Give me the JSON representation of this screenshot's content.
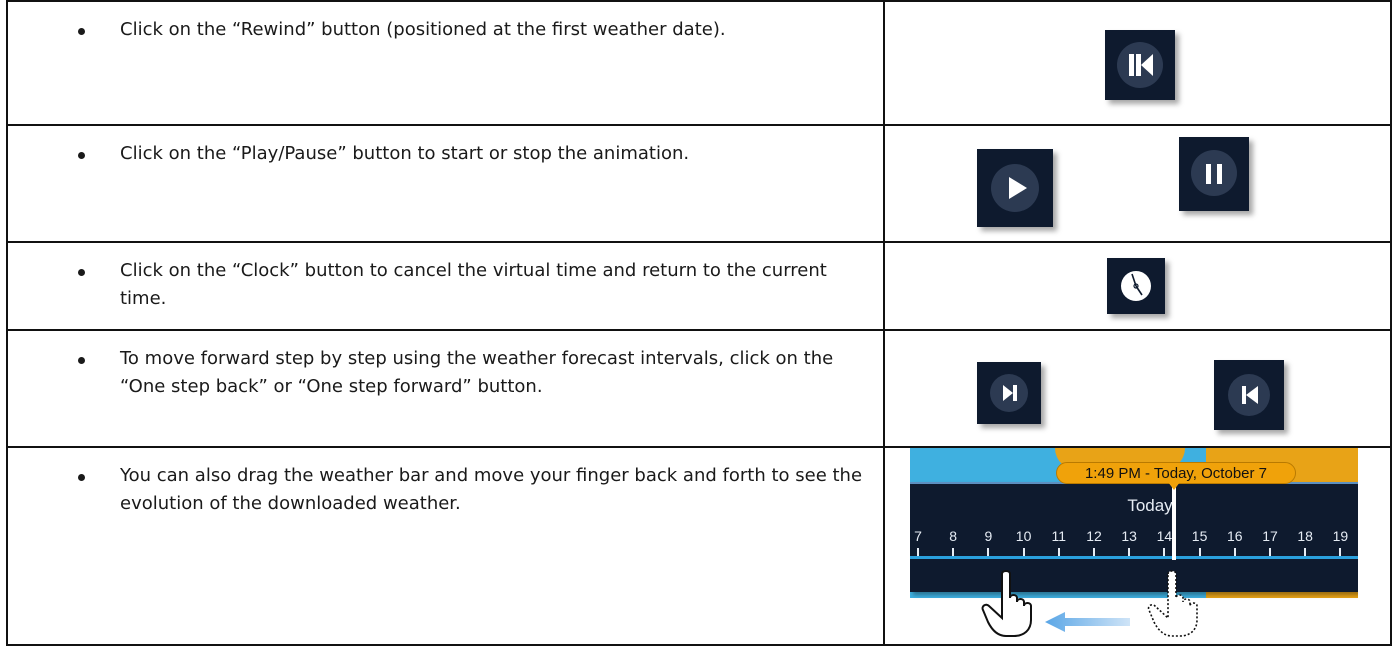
{
  "rows": [
    {
      "text": "Click on the “Rewind” button (positioned at the first weather date).",
      "icon": "rewind-icon"
    },
    {
      "text": "Click on the “Play/Pause” button to start or stop the animation.",
      "icons": [
        "play-icon",
        "pause-icon"
      ]
    },
    {
      "text": "Click on the “Clock” button to cancel the virtual time and return to the current time.",
      "icon": "clock-icon"
    },
    {
      "text": "To move forward step by step using the weather forecast intervals, click on the “One step back” or “One step forward” button.",
      "icons": [
        "step-forward-icon",
        "step-back-icon"
      ]
    },
    {
      "text": "You can also drag the weather bar and move your finger back and forth to see the evolution of the downloaded weather.",
      "icon": "weather-bar-image"
    }
  ],
  "weather_bar": {
    "time_label": "1:49 PM - Today, October 7",
    "day_label": "Today",
    "hours": [
      "7",
      "8",
      "9",
      "10",
      "11",
      "12",
      "13",
      "14",
      "15",
      "16",
      "17",
      "18",
      "19"
    ]
  },
  "colors": {
    "button_bg": "#0e1a2e",
    "button_disc": "#2c3a52",
    "bar_orange": "#f0a20a",
    "sky_blue": "#3fb0e0"
  }
}
